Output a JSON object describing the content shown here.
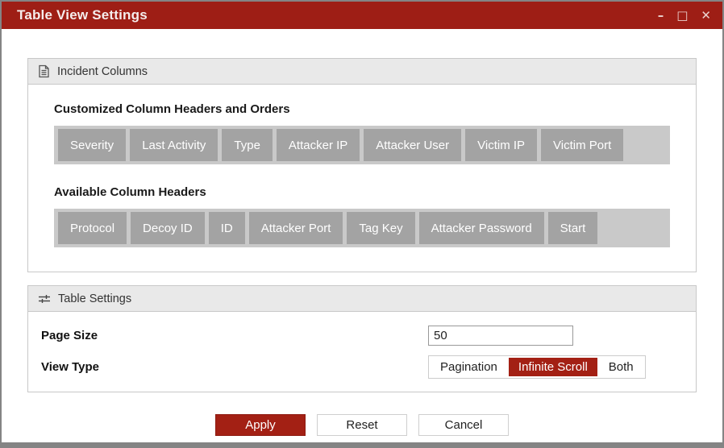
{
  "window": {
    "title": "Table View Settings",
    "controls": {
      "minimize": "–",
      "maximize": "□",
      "close": "✕"
    }
  },
  "colors": {
    "accent_red": "#9E1E15",
    "chip_bg": "#a3a3a3",
    "chip_track_bg": "#c9c9c9",
    "section_header_bg": "#e9e9e9"
  },
  "incident_columns": {
    "title": "Incident Columns",
    "customized_label": "Customized Column Headers and Orders",
    "customized_chips": [
      "Severity",
      "Last Activity",
      "Type",
      "Attacker IP",
      "Attacker User",
      "Victim IP",
      "Victim Port"
    ],
    "available_label": "Available Column Headers",
    "available_chips": [
      "Protocol",
      "Decoy ID",
      "ID",
      "Attacker Port",
      "Tag Key",
      "Attacker Password",
      "Start"
    ]
  },
  "table_settings": {
    "title": "Table Settings",
    "page_size_label": "Page Size",
    "page_size_value": "50",
    "view_type_label": "View Type",
    "view_type_options": [
      "Pagination",
      "Infinite Scroll",
      "Both"
    ],
    "view_type_selected": "Infinite Scroll"
  },
  "footer": {
    "apply": "Apply",
    "reset": "Reset",
    "cancel": "Cancel"
  }
}
